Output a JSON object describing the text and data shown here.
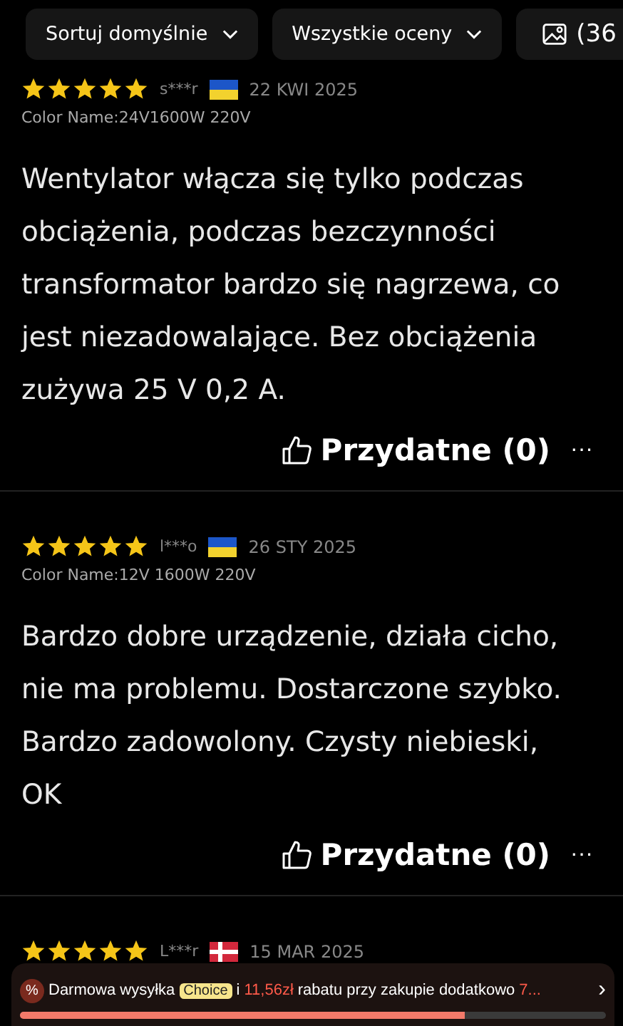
{
  "filters": [
    {
      "label": "Sortuj domyślnie",
      "kind": "dropdown"
    },
    {
      "label": "Wszystkie oceny",
      "kind": "dropdown"
    },
    {
      "label": "(36",
      "kind": "photo"
    }
  ],
  "reviews": [
    {
      "stars": 5,
      "user": "s***r",
      "kind": "ua",
      "date": "22 KWI 2025",
      "variant": "Color Name:24V1600W 220V",
      "text": "Wentylator włącza się tylko podczas obciążenia, podczas bezczynności transformator bardzo się nagrzewa, co jest niezadowalające. Bez obciążenia zużywa 25 V 0,2 A.",
      "helpful": "Przydatne (0)",
      "more": "···"
    },
    {
      "stars": 5,
      "user": "l***o",
      "kind": "ua",
      "date": "26 STY 2025",
      "variant": "Color Name:12V 1600W 220V",
      "text": "Bardzo dobre urządzenie, działa cicho, nie ma problemu. Dostarczone szybko. Bardzo zadowolony. Czysty niebieski, OK",
      "helpful": "Przydatne (0)",
      "more": "···"
    },
    {
      "stars": 5,
      "user": "L***r",
      "kind": "dk",
      "date": "15 MAR 2025"
    }
  ],
  "banner": {
    "icon": "%",
    "segments": [
      {
        "kind": "text",
        "text": "Darmowa wysyłka"
      },
      {
        "kind": "badge",
        "text": "Choice"
      },
      {
        "kind": "text",
        "text": "i"
      },
      {
        "kind": "highlight",
        "text": "11,56zł"
      },
      {
        "kind": "text",
        "text": "rabatu przy zakupie dodatkowo"
      },
      {
        "kind": "highlight",
        "text": "7..."
      }
    ],
    "arrow": "›",
    "level": 0.76
  }
}
